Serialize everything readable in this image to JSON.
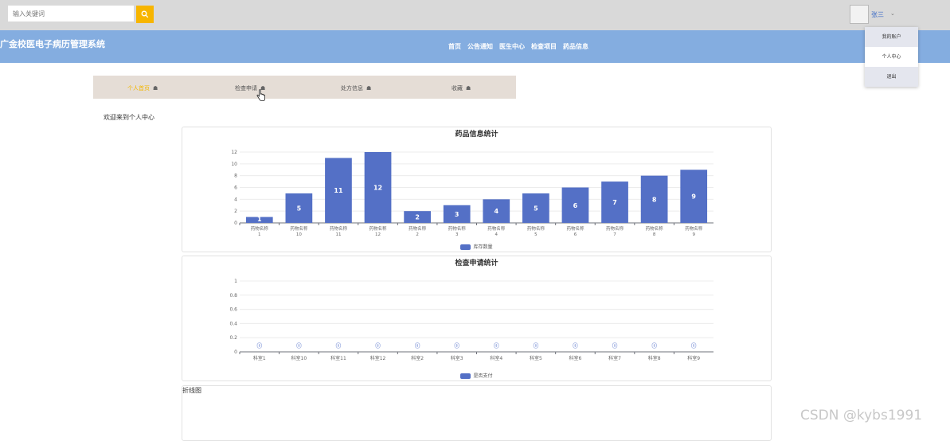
{
  "header": {
    "search_placeholder": "输入关键词",
    "user_name": "张三",
    "user_caret": "⌄",
    "user_menu": [
      "我的账户",
      "个人中心",
      "退出"
    ]
  },
  "nav": {
    "site_title": "广金校医电子病历管理系统",
    "links": [
      "首页",
      "公告通知",
      "医生中心",
      "检查项目",
      "药品信息"
    ]
  },
  "tabs": {
    "items": [
      "个人首页",
      "检查申请",
      "处方信息",
      "收藏"
    ],
    "active_index": 0
  },
  "welcome_text": "欢迎来到个人中心",
  "line_chart_label": "折线图",
  "watermark": "CSDN @kybs1991",
  "colors": {
    "bar": "#5470c6",
    "accent": "#f2b600",
    "navbar": "#84ade0"
  },
  "chart_data": [
    {
      "type": "bar",
      "title": "药品信息统计",
      "categories": [
        "药物名称1",
        "药物名称10",
        "药物名称11",
        "药物名称12",
        "药物名称2",
        "药物名称3",
        "药物名称4",
        "药物名称5",
        "药物名称6",
        "药物名称7",
        "药物名称8",
        "药物名称9"
      ],
      "series": [
        {
          "name": "库存数量",
          "values": [
            1,
            5,
            11,
            12,
            2,
            3,
            4,
            5,
            6,
            7,
            8,
            9
          ]
        }
      ],
      "ylim": [
        0,
        12
      ],
      "yticks": [
        0,
        2,
        4,
        6,
        8,
        10,
        12
      ],
      "legend_position": "bottom",
      "grid": true
    },
    {
      "type": "bar",
      "title": "检查申请统计",
      "categories": [
        "科室1",
        "科室10",
        "科室11",
        "科室12",
        "科室2",
        "科室3",
        "科室4",
        "科室5",
        "科室6",
        "科室7",
        "科室8",
        "科室9"
      ],
      "series": [
        {
          "name": "是否支付",
          "values": [
            0,
            0,
            0,
            0,
            0,
            0,
            0,
            0,
            0,
            0,
            0,
            0
          ]
        }
      ],
      "ylim": [
        0,
        1
      ],
      "yticks": [
        0,
        0.2,
        0.4,
        0.6,
        0.8,
        1
      ],
      "legend_position": "bottom",
      "grid": true
    }
  ]
}
